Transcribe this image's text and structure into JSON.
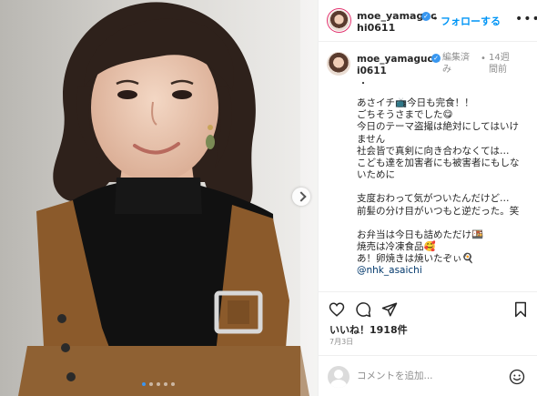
{
  "post": {
    "username": "moe_yamaguchi0611",
    "follow_label": "フォローする",
    "separator": "•",
    "more_label": "•••",
    "edited_label": "編集済み",
    "time_ago": "14週間前",
    "caption_bullet": "・",
    "caption_lines": [
      "あさイチ📺今日も完食！！",
      "ごちそうさまでした😋",
      "今日のテーマ盗撮は絶対にしてはいけません",
      "社会皆で真剣に向き合わなくては…",
      "こども達を加害者にも被害者にもしないために",
      "",
      "支度おわって気がついたんだけど…",
      "前髪の分け目がいつもと逆だった。笑",
      "",
      "お弁当は今日も詰めただけ🍱",
      "焼売は冷凍食品🥰",
      "あ！卵焼きは焼いたぞぃ🍳"
    ],
    "mention": "@nhk_asaichi",
    "likes_text": "いいね！1918件",
    "date_text": "7月3日",
    "comment_placeholder": "コメントを追加...",
    "carousel": {
      "total": 5,
      "active": 0
    }
  },
  "icons": {
    "verified": "verified-badge-icon",
    "like": "heart-icon",
    "comment": "comment-bubble-icon",
    "share": "paper-plane-icon",
    "save": "bookmark-icon",
    "emoji": "smiley-icon",
    "next": "chevron-right-icon"
  },
  "colors": {
    "link_blue": "#0095f6",
    "verified_blue": "#3897f0",
    "muted_text": "#8e8e8e",
    "mention_text": "#00376b",
    "active_dot": "#3b95f0"
  }
}
